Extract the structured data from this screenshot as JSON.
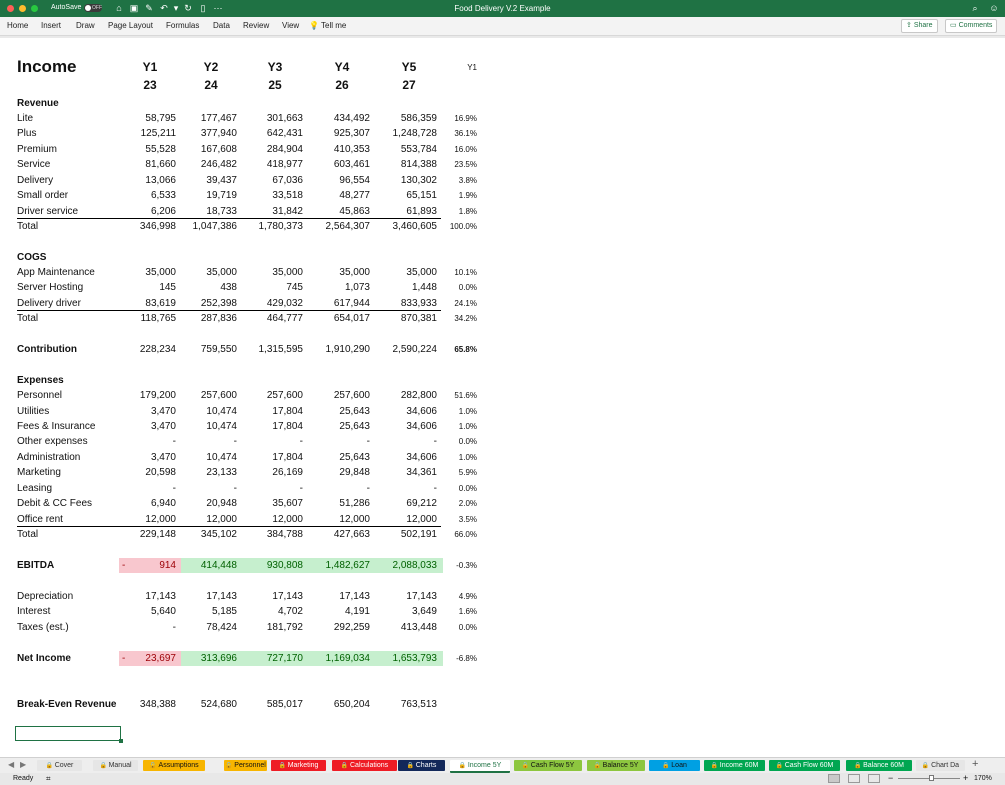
{
  "titlebar": {
    "autosave_label": "AutoSave",
    "toggle_state": "OFF",
    "doc_title": "Food Delivery V.2 Example",
    "colors": {
      "green": "#1f7244"
    }
  },
  "menubar": {
    "items": [
      "Home",
      "Insert",
      "Draw",
      "Page Layout",
      "Formulas",
      "Data",
      "Review",
      "View"
    ],
    "tell_me": "Tell me",
    "share": "Share",
    "comments": "Comments"
  },
  "sheet": {
    "title": "Income",
    "years": [
      "Y1",
      "Y2",
      "Y3",
      "Y4",
      "Y5"
    ],
    "year_nums": [
      "23",
      "24",
      "25",
      "26",
      "27"
    ],
    "pct_header": "Y1",
    "revenue_header": "Revenue",
    "revenue": [
      {
        "label": "Lite",
        "v": [
          "58,795",
          "177,467",
          "301,663",
          "434,492",
          "586,359"
        ],
        "p": "16.9%"
      },
      {
        "label": "Plus",
        "v": [
          "125,211",
          "377,940",
          "642,431",
          "925,307",
          "1,248,728"
        ],
        "p": "36.1%"
      },
      {
        "label": "Premium",
        "v": [
          "55,528",
          "167,608",
          "284,904",
          "410,353",
          "553,784"
        ],
        "p": "16.0%"
      },
      {
        "label": "Service",
        "v": [
          "81,660",
          "246,482",
          "418,977",
          "603,461",
          "814,388"
        ],
        "p": "23.5%"
      },
      {
        "label": "Delivery",
        "v": [
          "13,066",
          "39,437",
          "67,036",
          "96,554",
          "130,302"
        ],
        "p": "3.8%"
      },
      {
        "label": "Small order",
        "v": [
          "6,533",
          "19,719",
          "33,518",
          "48,277",
          "65,151"
        ],
        "p": "1.9%"
      },
      {
        "label": "Driver service",
        "v": [
          "6,206",
          "18,733",
          "31,842",
          "45,863",
          "61,893"
        ],
        "p": "1.8%"
      }
    ],
    "revenue_total": {
      "label": "Total",
      "v": [
        "346,998",
        "1,047,386",
        "1,780,373",
        "2,564,307",
        "3,460,605"
      ],
      "p": "100.0%"
    },
    "cogs_header": "COGS",
    "cogs": [
      {
        "label": "App Maintenance",
        "v": [
          "35,000",
          "35,000",
          "35,000",
          "35,000",
          "35,000"
        ],
        "p": "10.1%"
      },
      {
        "label": "Server Hosting",
        "v": [
          "145",
          "438",
          "745",
          "1,073",
          "1,448"
        ],
        "p": "0.0%"
      },
      {
        "label": "Delivery driver",
        "v": [
          "83,619",
          "252,398",
          "429,032",
          "617,944",
          "833,933"
        ],
        "p": "24.1%"
      }
    ],
    "cogs_total": {
      "label": "Total",
      "v": [
        "118,765",
        "287,836",
        "464,777",
        "654,017",
        "870,381"
      ],
      "p": "34.2%"
    },
    "contribution": {
      "label": "Contribution",
      "v": [
        "228,234",
        "759,550",
        "1,315,595",
        "1,910,290",
        "2,590,224"
      ],
      "p": "65.8%"
    },
    "expenses_header": "Expenses",
    "expenses": [
      {
        "label": "Personnel",
        "v": [
          "179,200",
          "257,600",
          "257,600",
          "257,600",
          "282,800"
        ],
        "p": "51.6%"
      },
      {
        "label": "Utilities",
        "v": [
          "3,470",
          "10,474",
          "17,804",
          "25,643",
          "34,606"
        ],
        "p": "1.0%"
      },
      {
        "label": "Fees & Insurance",
        "v": [
          "3,470",
          "10,474",
          "17,804",
          "25,643",
          "34,606"
        ],
        "p": "1.0%"
      },
      {
        "label": "Other expenses",
        "v": [
          "-",
          "-",
          "-",
          "-",
          "-"
        ],
        "p": "0.0%"
      },
      {
        "label": "Administration",
        "v": [
          "3,470",
          "10,474",
          "17,804",
          "25,643",
          "34,606"
        ],
        "p": "1.0%"
      },
      {
        "label": "Marketing",
        "v": [
          "20,598",
          "23,133",
          "26,169",
          "29,848",
          "34,361"
        ],
        "p": "5.9%"
      },
      {
        "label": "Leasing",
        "v": [
          "-",
          "-",
          "-",
          "-",
          "-"
        ],
        "p": "0.0%"
      },
      {
        "label": "Debit & CC Fees",
        "v": [
          "6,940",
          "20,948",
          "35,607",
          "51,286",
          "69,212"
        ],
        "p": "2.0%"
      },
      {
        "label": "Office rent",
        "v": [
          "12,000",
          "12,000",
          "12,000",
          "12,000",
          "12,000"
        ],
        "p": "3.5%"
      }
    ],
    "expenses_total": {
      "label": "Total",
      "v": [
        "229,148",
        "345,102",
        "384,788",
        "427,663",
        "502,191"
      ],
      "p": "66.0%"
    },
    "ebitda": {
      "label": "EBITDA",
      "neg": "-",
      "v": [
        "914",
        "414,448",
        "930,808",
        "1,482,627",
        "2,088,033"
      ],
      "p": "-0.3%"
    },
    "other": [
      {
        "label": "Depreciation",
        "v": [
          "17,143",
          "17,143",
          "17,143",
          "17,143",
          "17,143"
        ],
        "p": "4.9%"
      },
      {
        "label": "Interest",
        "v": [
          "5,640",
          "5,185",
          "4,702",
          "4,191",
          "3,649"
        ],
        "p": "1.6%"
      },
      {
        "label": "Taxes (est.)",
        "v": [
          "-",
          "78,424",
          "181,792",
          "292,259",
          "413,448"
        ],
        "p": "0.0%"
      }
    ],
    "net_income": {
      "label": "Net Income",
      "neg": "-",
      "v": [
        "23,697",
        "313,696",
        "727,170",
        "1,169,034",
        "1,653,793"
      ],
      "p": "-6.8%"
    },
    "break_even": {
      "label": "Break-Even Revenue",
      "v": [
        "348,388",
        "524,680",
        "585,017",
        "650,204",
        "763,513"
      ]
    },
    "colors": {
      "neg_fill": "#f8c7ce",
      "neg_text": "#9c0006",
      "pos_fill": "#c6efce",
      "pos_text": "#006100"
    }
  },
  "tabs": [
    {
      "name": "Cover",
      "bg": "#e6e6e6",
      "fg": "#333",
      "lock": true
    },
    {
      "name": "Manual",
      "bg": "#e6e6e6",
      "fg": "#333",
      "lock": true
    },
    {
      "name": "Assumptions",
      "bg": "#f7b500",
      "fg": "#111",
      "lock": true
    },
    {
      "name": "Personnel",
      "bg": "#f7b500",
      "fg": "#111",
      "lock": true
    },
    {
      "name": "Marketing",
      "bg": "#ee1c25",
      "fg": "#fff",
      "lock": true
    },
    {
      "name": "Calculations",
      "bg": "#ee1c25",
      "fg": "#fff",
      "lock": true
    },
    {
      "name": "Charts",
      "bg": "#13285a",
      "fg": "#fff",
      "lock": true
    },
    {
      "name": "Income 5Y",
      "bg": "#ffffff",
      "fg": "#1f7244",
      "lock": true,
      "active": true
    },
    {
      "name": "Cash Flow 5Y",
      "bg": "#8dc63f",
      "fg": "#111",
      "lock": true
    },
    {
      "name": "Balance 5Y",
      "bg": "#8dc63f",
      "fg": "#111",
      "lock": true
    },
    {
      "name": "Loan",
      "bg": "#00a0e3",
      "fg": "#111",
      "lock": true
    },
    {
      "name": "Income 60M",
      "bg": "#00a651",
      "fg": "#fff",
      "lock": true
    },
    {
      "name": "Cash Flow 60M",
      "bg": "#00a651",
      "fg": "#fff",
      "lock": true
    },
    {
      "name": "Balance 60M",
      "bg": "#00a651",
      "fg": "#fff",
      "lock": true
    },
    {
      "name": "Chart Da",
      "bg": "#e6e6e6",
      "fg": "#333",
      "lock": true
    }
  ],
  "status": {
    "ready": "Ready",
    "zoom": "170%"
  }
}
